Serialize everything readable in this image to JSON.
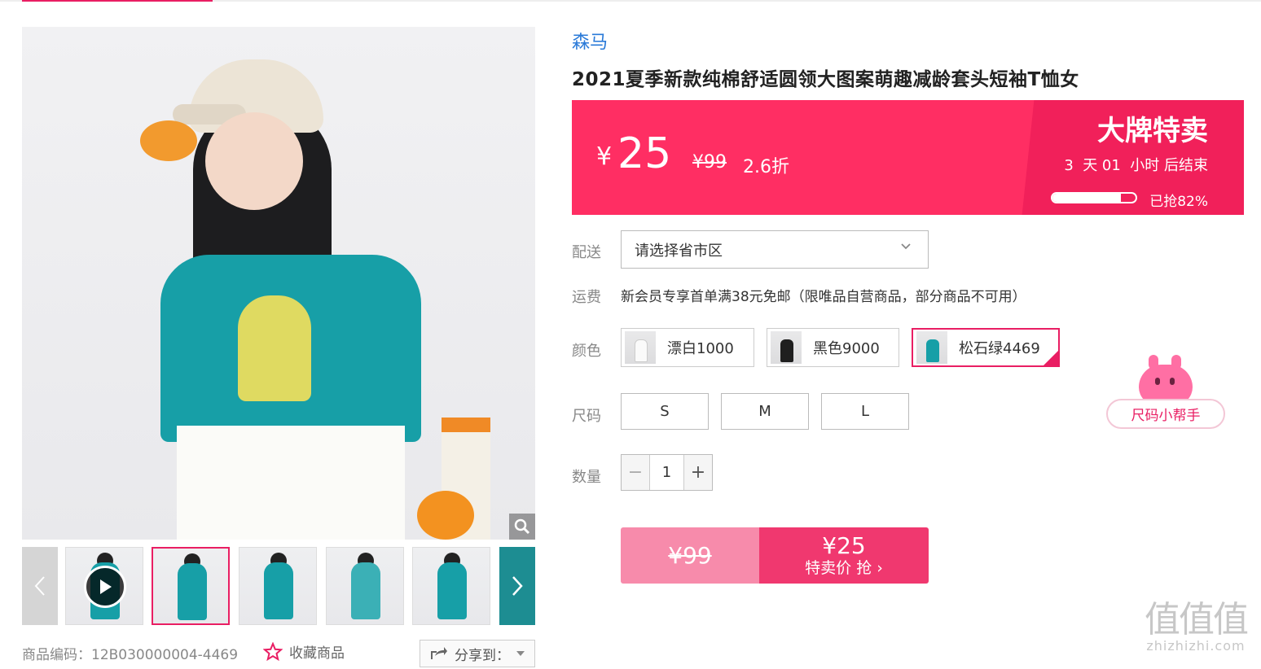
{
  "product": {
    "brand": "森马",
    "title": "2021夏季新款纯棉舒适圆领大图案萌趣减龄套头短袖T恤女",
    "code_label": "商品编码：12B030000004-4469",
    "favorite_label": "收藏商品",
    "share_label": "分享到："
  },
  "price": {
    "currency": "¥",
    "sale": "25",
    "original": "¥99",
    "discount": "2.6折",
    "event_title": "大牌特卖",
    "countdown": "3  天 01  小时 后结束",
    "sold_label": "已抢82%",
    "sold_fraction": 0.82
  },
  "delivery": {
    "label": "配送",
    "placeholder": "请选择省市区"
  },
  "shipping": {
    "label": "运费",
    "text": "新会员专享首单满38元免邮（限唯品自营商品，部分商品不可用）"
  },
  "colors": {
    "label": "颜色",
    "options": [
      "漂白1000",
      "黑色9000",
      "松石绿4469"
    ],
    "selected": "松石绿4469"
  },
  "sizes": {
    "label": "尺码",
    "options": [
      "S",
      "M",
      "L"
    ],
    "helper": "尺码小帮手"
  },
  "quantity": {
    "label": "数量",
    "value": "1",
    "minus": "−",
    "plus": "+"
  },
  "buy": {
    "original": "¥99",
    "price": "¥25",
    "action": "特卖价 抢 ›"
  },
  "watermark": {
    "big": "值值值",
    "small": "zhizhizhi.com"
  },
  "colors_theme": {
    "accent": "#e91e63",
    "price_bg": "#ff2e63",
    "brand_link": "#2a7ad8"
  }
}
